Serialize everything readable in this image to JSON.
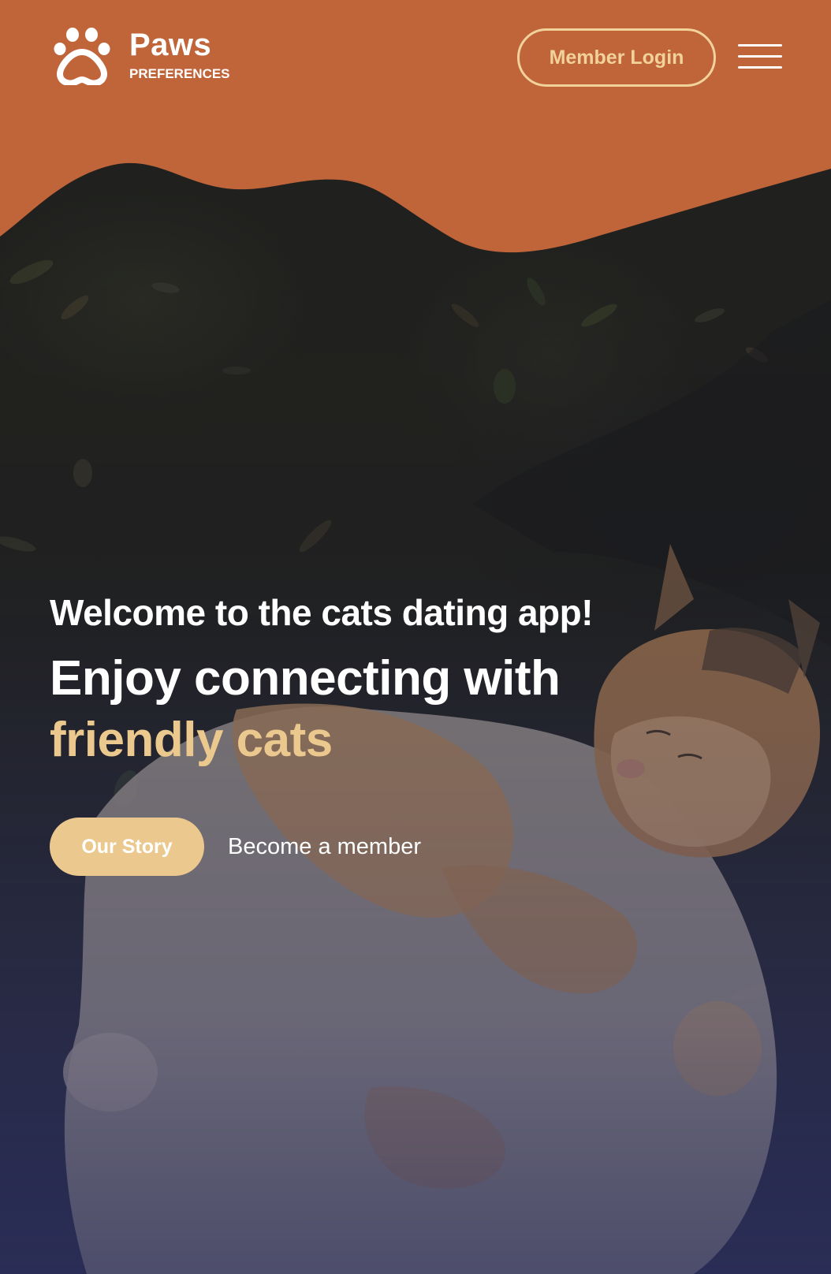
{
  "colors": {
    "header_bg": "#c0643a",
    "accent": "#ebc88d",
    "outline": "#f1d29a",
    "text": "#ffffff"
  },
  "brand": {
    "logo_icon": "paw-icon",
    "name": "Paws",
    "tagline": "PREFERENCES"
  },
  "nav": {
    "login_label": "Member Login",
    "menu_icon": "hamburger-menu-icon"
  },
  "hero": {
    "image_subject": "cat",
    "welcome": "Welcome to the cats dating app!",
    "headline_main": "Enjoy connecting with",
    "headline_accent": "friendly cats",
    "primary_cta": "Our Story",
    "secondary_cta": "Become a member"
  }
}
